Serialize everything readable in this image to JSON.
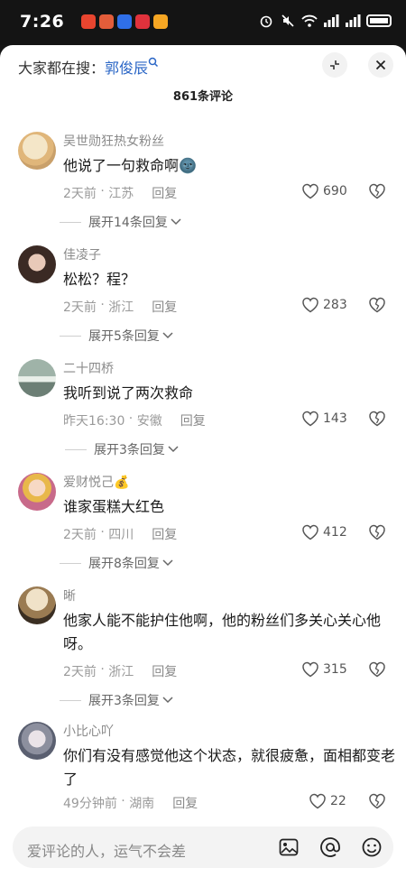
{
  "status_bar": {
    "time": "7:26"
  },
  "header": {
    "search_prefix": "大家都在搜：",
    "search_keyword": "郭俊辰",
    "comment_count": "861条评论"
  },
  "comments": [
    {
      "user": "吴世勋狂热女粉丝",
      "text": "他说了一句救命啊🌚",
      "time": "2天前",
      "location": "江苏",
      "reply_label": "回复",
      "likes": "690",
      "expand": "展开14条回复"
    },
    {
      "user": "佳凌子",
      "text": "松松？程？",
      "time": "2天前",
      "location": "浙江",
      "reply_label": "回复",
      "likes": "283",
      "expand": "展开5条回复"
    },
    {
      "user": "二十四桥",
      "text": "我听到说了两次救命",
      "time": "昨天16:30",
      "location": "安徽",
      "reply_label": "回复",
      "likes": "143",
      "expand": "展开3条回复"
    },
    {
      "user": "爱财悦己💰",
      "text": "谁家蛋糕大红色",
      "time": "2天前",
      "location": "四川",
      "reply_label": "回复",
      "likes": "412",
      "expand": "展开8条回复"
    },
    {
      "user": "晰",
      "text": "他家人能不能护住他啊，他的粉丝们多关心关心他呀。",
      "time": "2天前",
      "location": "浙江",
      "reply_label": "回复",
      "likes": "315",
      "expand": "展开3条回复"
    },
    {
      "user": "小比心吖",
      "text": "你们有没有感觉他这个状态，就很疲惫，面相都变老了",
      "time": "49分钟前",
      "location": "湖南",
      "reply_label": "回复",
      "likes": "22",
      "expand": ""
    }
  ],
  "input": {
    "placeholder": "爱评论的人，运气不会差"
  },
  "icons": {
    "status": [
      "alarm-icon",
      "mute-icon",
      "wifi-icon",
      "signal-icon",
      "signal-icon",
      "battery-icon"
    ],
    "header": [
      "collapse-icon",
      "close-icon"
    ],
    "comment": [
      "heart-icon",
      "dislike-icon",
      "chevron-down-icon"
    ],
    "bottom": [
      "image-icon",
      "at-icon",
      "emoji-icon"
    ]
  },
  "colors": {
    "accent_link": "#2a66c6",
    "muted_text": "#9a9a9a",
    "sheet_bg": "#ffffff",
    "status_bg": "#141414"
  }
}
